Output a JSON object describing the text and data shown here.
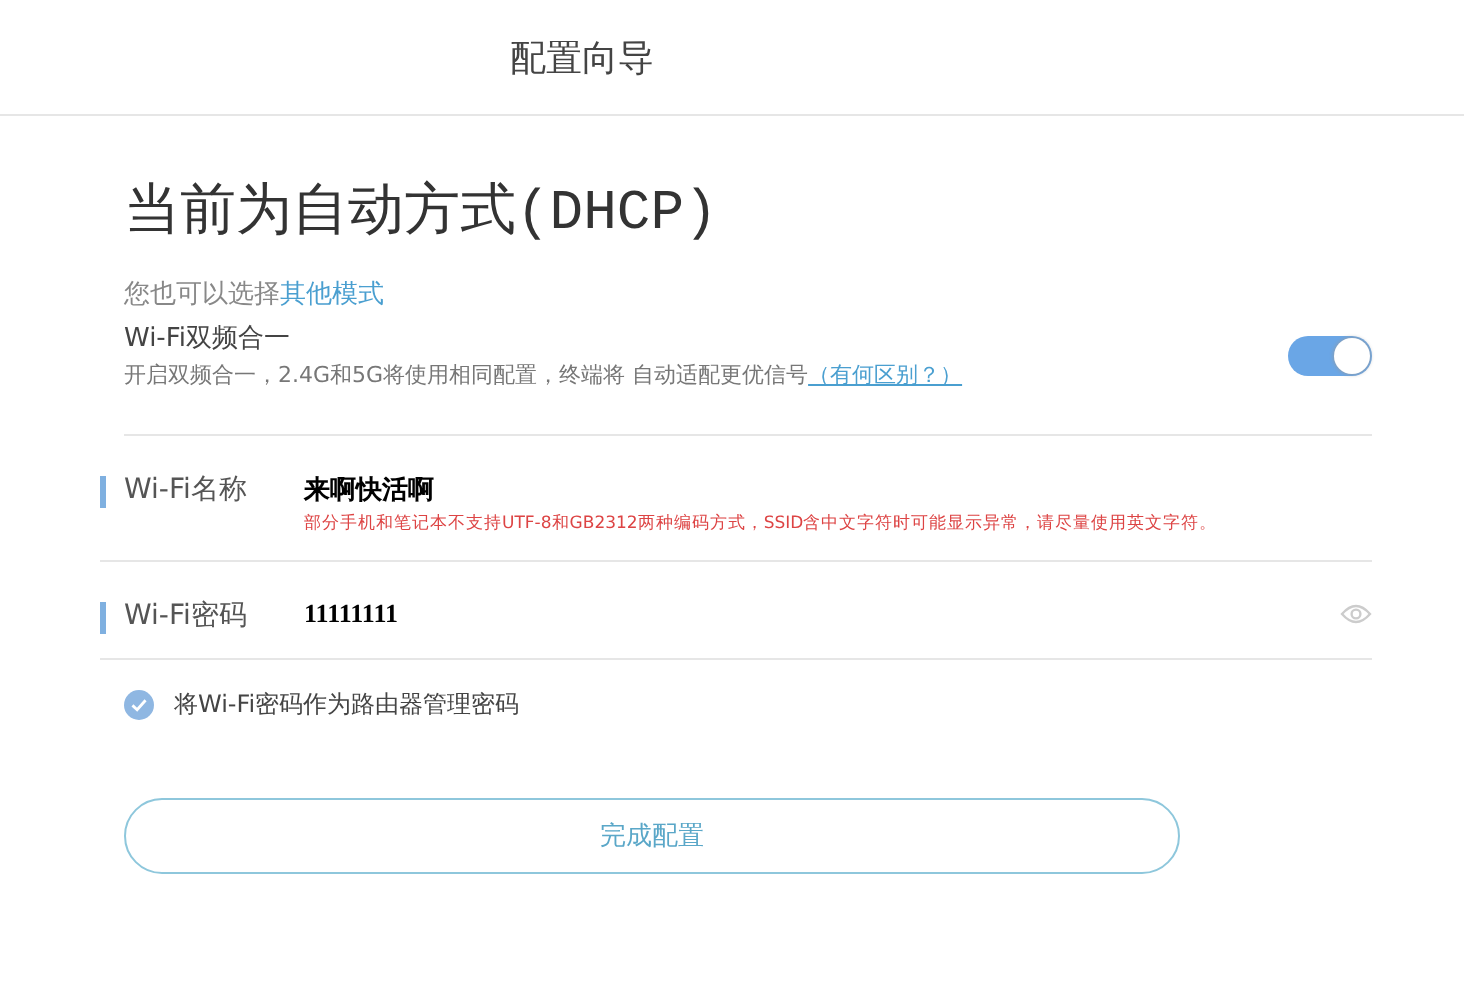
{
  "header": {
    "title": "配置向导"
  },
  "mode_title": "当前为自动方式(DHCP)",
  "mode_hint": {
    "text": "您也可以选择",
    "link": "其他模式"
  },
  "dual_band": {
    "label": "Wi-Fi双频合一",
    "description": "开启双频合一，2.4G和5G将使用相同配置，终端将 自动适配更优信号",
    "link": "（有何区别？）",
    "on": true
  },
  "fields": [
    {
      "label": "Wi-Fi名称",
      "value": "来啊快活啊",
      "warning": "部分手机和笔记本不支持UTF-8和GB2312两种编码方式，SSID含中文字符时可能显示异常，请尽量使用英文字符。",
      "kind": "text"
    },
    {
      "label": "Wi-Fi密码",
      "value": "11111111",
      "kind": "password"
    }
  ],
  "same_password": {
    "label": "将Wi-Fi密码作为路由器管理密码",
    "checked": true
  },
  "submit": "完成配置"
}
